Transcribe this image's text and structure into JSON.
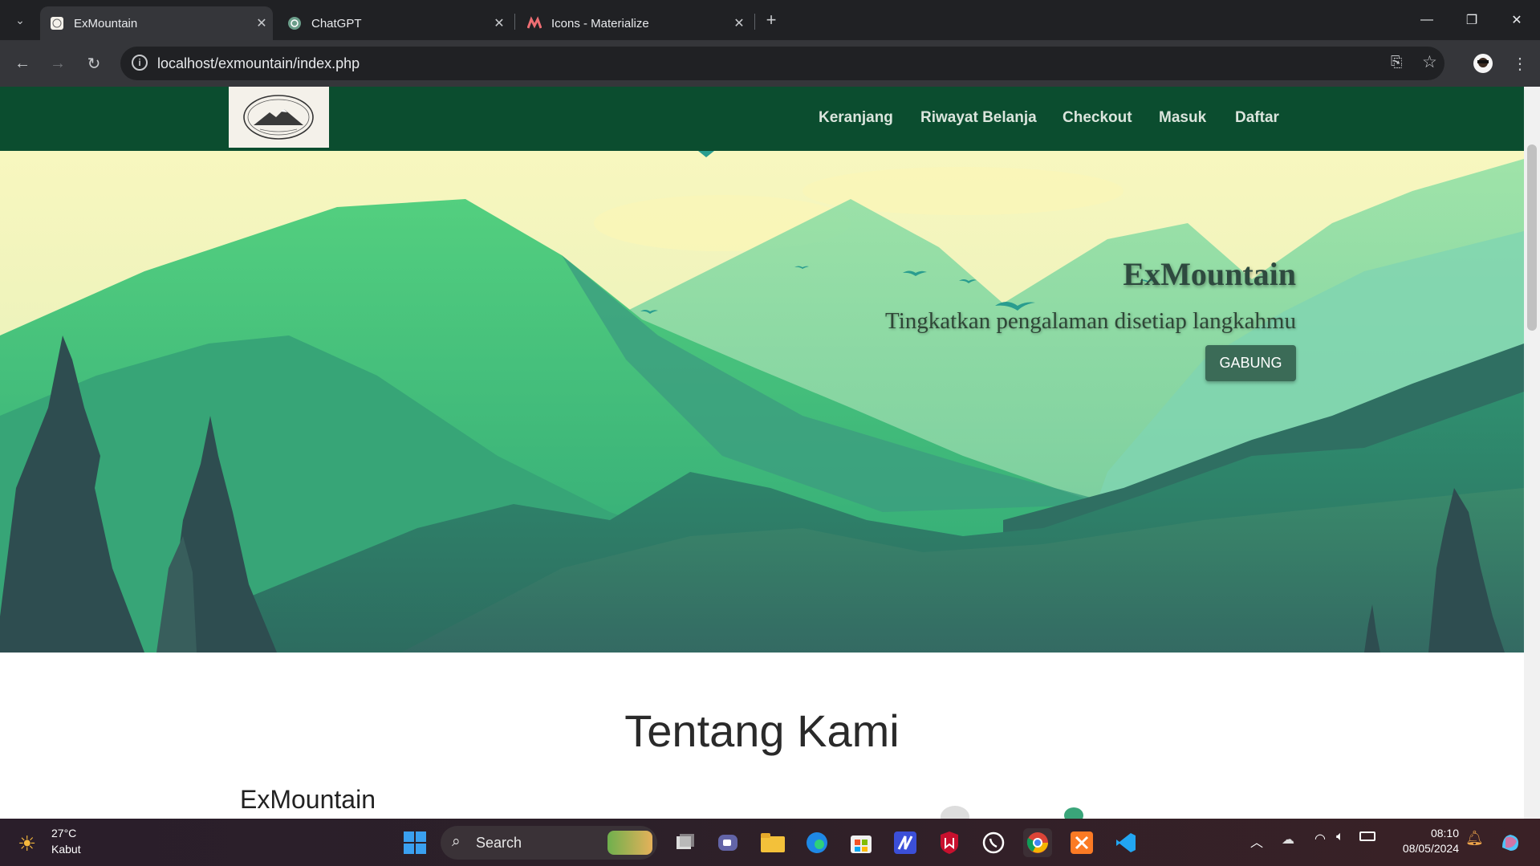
{
  "browser": {
    "tabs": [
      {
        "title": "ExMountain",
        "active": true
      },
      {
        "title": "ChatGPT",
        "active": false
      },
      {
        "title": "Icons - Materialize",
        "active": false
      }
    ],
    "url": "localhost/exmountain/index.php"
  },
  "site": {
    "nav": [
      "Keranjang",
      "Riwayat Belanja",
      "Checkout",
      "Masuk",
      "Daftar"
    ],
    "hero": {
      "title": "ExMountain",
      "subtitle": "Tingkatkan pengalaman disetiap langkahmu",
      "button": "GABUNG"
    },
    "about": {
      "title": "Tentang Kami",
      "subtitle": "ExMountain"
    },
    "colors": {
      "navbar": "#0b4d2f",
      "button": "#3b6b57"
    }
  },
  "taskbar": {
    "weather_temp": "27°C",
    "weather_desc": "Kabut",
    "search_placeholder": "Search",
    "time": "08:10",
    "date": "08/05/2024"
  }
}
